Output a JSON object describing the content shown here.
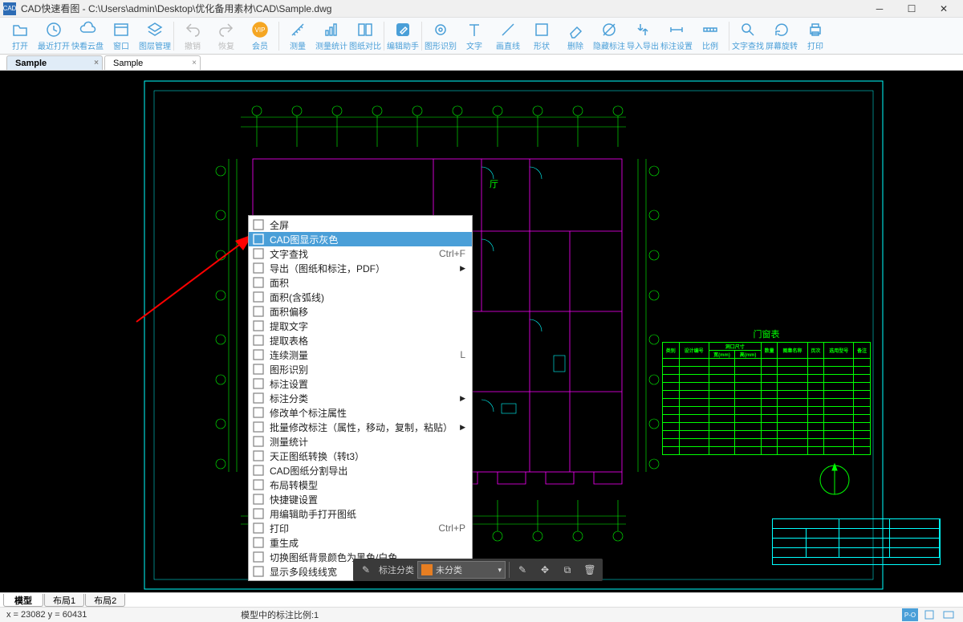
{
  "window": {
    "title": "CAD快速看图 - C:\\Users\\admin\\Desktop\\优化备用素材\\CAD\\Sample.dwg"
  },
  "toolbar": [
    {
      "label": "打开",
      "icon": "folder"
    },
    {
      "label": "最近打开",
      "icon": "recent"
    },
    {
      "label": "快看云盘",
      "icon": "cloud"
    },
    {
      "label": "窗口",
      "icon": "window"
    },
    {
      "label": "图层管理",
      "icon": "layers"
    },
    {
      "sep": true
    },
    {
      "label": "撤销",
      "icon": "undo",
      "dim": true
    },
    {
      "label": "恢复",
      "icon": "redo",
      "dim": true
    },
    {
      "label": "会员",
      "icon": "vip",
      "vip": true
    },
    {
      "sep": true
    },
    {
      "label": "测量",
      "icon": "measure"
    },
    {
      "label": "测量统计",
      "icon": "stats"
    },
    {
      "label": "图纸对比",
      "icon": "compare"
    },
    {
      "sep": true
    },
    {
      "label": "编辑助手",
      "icon": "edit",
      "blue": true
    },
    {
      "sep": true
    },
    {
      "label": "图形识别",
      "icon": "recognize"
    },
    {
      "label": "文字",
      "icon": "text"
    },
    {
      "label": "画直线",
      "icon": "line"
    },
    {
      "label": "形状",
      "icon": "shape"
    },
    {
      "label": "删除",
      "icon": "erase"
    },
    {
      "label": "隐藏标注",
      "icon": "hide"
    },
    {
      "label": "导入导出",
      "icon": "io"
    },
    {
      "label": "标注设置",
      "icon": "dimset"
    },
    {
      "label": "比例",
      "icon": "scale"
    },
    {
      "sep": true
    },
    {
      "label": "文字查找",
      "icon": "find"
    },
    {
      "label": "屏幕旋转",
      "icon": "rotate"
    },
    {
      "label": "打印",
      "icon": "print"
    }
  ],
  "tabs": [
    {
      "label": "Sample",
      "active": true
    },
    {
      "label": "Sample",
      "active": false
    }
  ],
  "context_menu": [
    {
      "label": "全屏"
    },
    {
      "label": "CAD图显示灰色",
      "hover": true
    },
    {
      "label": "文字查找",
      "shortcut": "Ctrl+F"
    },
    {
      "label": "导出（图纸和标注，PDF）",
      "sub": true
    },
    {
      "label": "面积"
    },
    {
      "label": "面积(含弧线)"
    },
    {
      "label": "面积偏移"
    },
    {
      "label": "提取文字"
    },
    {
      "label": "提取表格"
    },
    {
      "label": "连续测量",
      "shortcut": "L"
    },
    {
      "label": "图形识别"
    },
    {
      "label": "标注设置"
    },
    {
      "label": "标注分类",
      "sub": true
    },
    {
      "label": "修改单个标注属性"
    },
    {
      "label": "批量修改标注（属性，移动，复制，粘贴）",
      "sub": true
    },
    {
      "label": "测量统计"
    },
    {
      "label": "天正图纸转换（转t3）"
    },
    {
      "label": "CAD图纸分割导出"
    },
    {
      "label": "布局转模型"
    },
    {
      "label": "快捷键设置"
    },
    {
      "label": "用编辑助手打开图纸"
    },
    {
      "label": "打印",
      "shortcut": "Ctrl+P"
    },
    {
      "label": "重生成"
    },
    {
      "label": "切换图纸背景颜色为黑色/白色"
    },
    {
      "label": "显示多段线线宽"
    }
  ],
  "bottom_toolbar": {
    "label": "标注分类",
    "dropdown": "未分类"
  },
  "layout_tabs": [
    {
      "label": "模型",
      "active": true
    },
    {
      "label": "布局1"
    },
    {
      "label": "布局2"
    }
  ],
  "status": {
    "coords": "x = 23082  y = 60431",
    "info": "模型中的标注比例:1"
  },
  "door_table": {
    "title": "门窗表",
    "headers": [
      "类别",
      "设计编号",
      "洞口尺寸",
      "数量",
      "图集名称",
      "页次",
      "选用型号",
      "备注"
    ],
    "sub": [
      "宽(mm)",
      "高(mm)"
    ]
  },
  "drawing": {
    "room_label": "厅"
  }
}
